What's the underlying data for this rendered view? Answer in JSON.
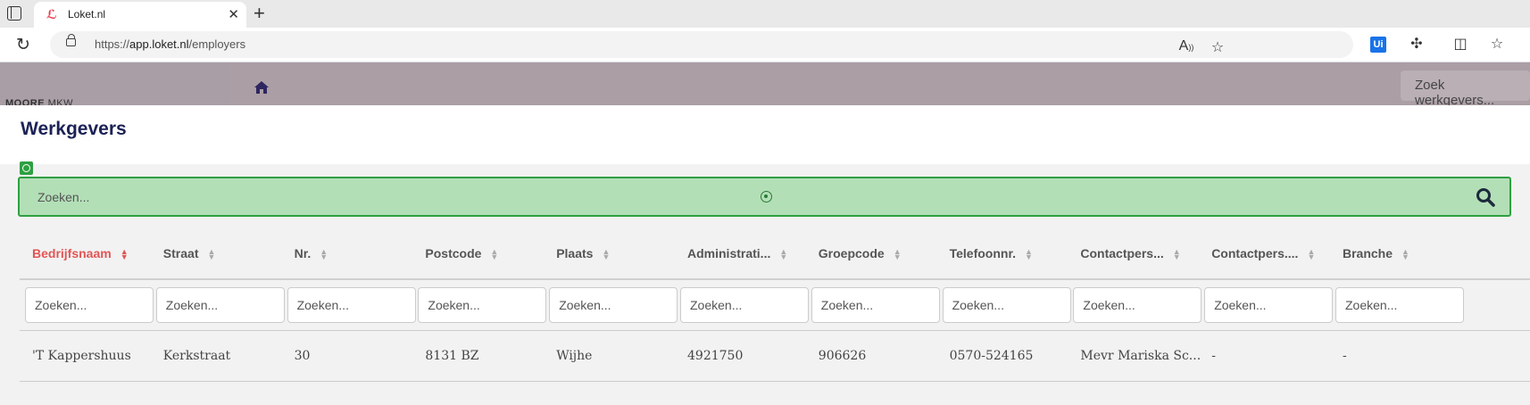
{
  "browser": {
    "tab_title": "Loket.nl",
    "tab_close": "✕",
    "new_tab": "+",
    "url_prefix": "https://",
    "url_host": "app.loket.nl",
    "url_path": "/employers"
  },
  "app": {
    "brand_bold": "MOORE",
    "brand_rest": " MKW",
    "header_search_placeholder": "Zoek werkgevers..."
  },
  "page": {
    "title": "Werkgevers",
    "search_placeholder": "Zoeken..."
  },
  "table": {
    "columns": [
      {
        "label": "Bedrijfsnaam",
        "active": true
      },
      {
        "label": "Straat"
      },
      {
        "label": "Nr."
      },
      {
        "label": "Postcode"
      },
      {
        "label": "Plaats"
      },
      {
        "label": "Administrati..."
      },
      {
        "label": "Groepcode"
      },
      {
        "label": "Telefoonnr."
      },
      {
        "label": "Contactpers..."
      },
      {
        "label": "Contactpers...."
      },
      {
        "label": "Branche"
      }
    ],
    "filter_placeholder": "Zoeken...",
    "rows": [
      [
        "'T Kappershuus",
        "Kerkstraat",
        "30",
        "8131 BZ",
        "Wijhe",
        "4921750",
        "906626",
        "0570-524165",
        "Mevr Mariska Sc...",
        "-",
        "-"
      ]
    ]
  },
  "colors": {
    "accent": "#e25555",
    "search_bg": "#b3dfb7",
    "search_border": "#2ea041",
    "title": "#1c2255"
  }
}
